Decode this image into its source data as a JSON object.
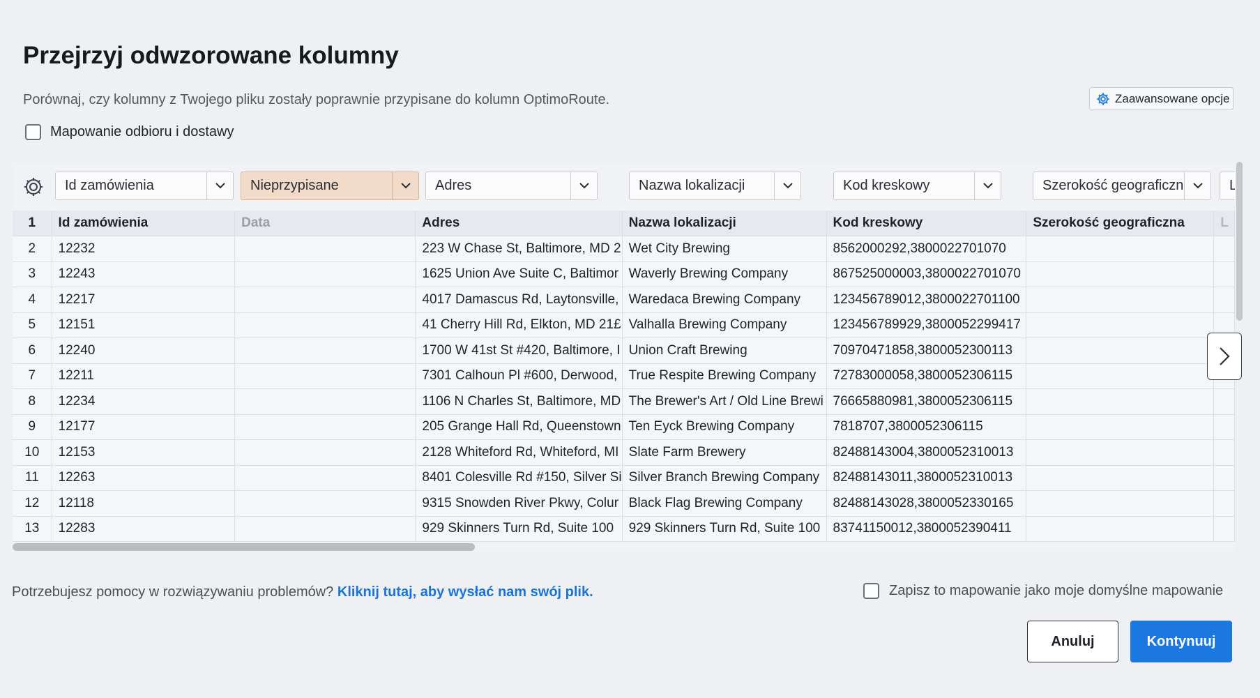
{
  "header": {
    "title": "Przejrzyj odwzorowane kolumny",
    "subtitle": "Porównaj, czy kolumny z Twojego pliku zostały poprawnie przypisane do kolumn OptimoRoute.",
    "advanced_button": "Zaawansowane opcje",
    "pickup_delivery_label": "Mapowanie odbioru i dostawy"
  },
  "mapping": {
    "gear_icon": "column-settings-icon",
    "selects": [
      "Id zamówienia",
      "Nieprzypisane",
      "Adres",
      "Nazwa lokalizacji",
      "Kod kreskowy",
      "Szerokość geograficzna",
      "L"
    ]
  },
  "table": {
    "header_row_number": "1",
    "headers": [
      "Id zamówienia",
      "Data",
      "Adres",
      "Nazwa lokalizacji",
      "Kod kreskowy",
      "Szerokość geograficzna",
      "L"
    ],
    "rows": [
      {
        "n": "2",
        "id": "12232",
        "date": "",
        "address": "223 W Chase St, Baltimore, MD 2",
        "location": "Wet City Brewing",
        "barcode": "8562000292,3800022701070",
        "lat": "",
        "extra": ""
      },
      {
        "n": "3",
        "id": "12243",
        "date": "",
        "address": "1625 Union Ave Suite C, Baltimor",
        "location": "Waverly Brewing Company",
        "barcode": "867525000003,3800022701070",
        "lat": "",
        "extra": ""
      },
      {
        "n": "4",
        "id": "12217",
        "date": "",
        "address": "4017 Damascus Rd, Laytonsville,",
        "location": "Waredaca Brewing Company",
        "barcode": "123456789012,3800022701100",
        "lat": "",
        "extra": ""
      },
      {
        "n": "5",
        "id": "12151",
        "date": "",
        "address": "41 Cherry Hill Rd, Elkton, MD 21£",
        "location": "Valhalla Brewing Company",
        "barcode": "123456789929,3800052299417",
        "lat": "",
        "extra": ""
      },
      {
        "n": "6",
        "id": "12240",
        "date": "",
        "address": "1700 W 41st St #420, Baltimore, I",
        "location": "Union Craft Brewing",
        "barcode": "70970471858,3800052300113",
        "lat": "",
        "extra": ""
      },
      {
        "n": "7",
        "id": "12211",
        "date": "",
        "address": "7301 Calhoun Pl #600, Derwood,",
        "location": "True Respite Brewing Company",
        "barcode": "72783000058,3800052306115",
        "lat": "",
        "extra": ""
      },
      {
        "n": "8",
        "id": "12234",
        "date": "",
        "address": "1106 N Charles St, Baltimore, MD",
        "location": "The Brewer's Art / Old Line Brewi",
        "barcode": "76665880981,3800052306115",
        "lat": "",
        "extra": ""
      },
      {
        "n": "9",
        "id": "12177",
        "date": "",
        "address": "205 Grange Hall Rd, Queenstown",
        "location": "Ten Eyck Brewing Company",
        "barcode": "7818707,3800052306115",
        "lat": "",
        "extra": ""
      },
      {
        "n": "10",
        "id": "12153",
        "date": "",
        "address": "2128 Whiteford Rd, Whiteford, MI",
        "location": "Slate Farm Brewery",
        "barcode": "82488143004,3800052310013",
        "lat": "",
        "extra": ""
      },
      {
        "n": "11",
        "id": "12263",
        "date": "",
        "address": "8401 Colesville Rd #150, Silver Si",
        "location": "Silver Branch Brewing Company",
        "barcode": "82488143011,3800052310013",
        "lat": "",
        "extra": ""
      },
      {
        "n": "12",
        "id": "12118",
        "date": "",
        "address": "9315 Snowden River Pkwy, Colur",
        "location": "Black Flag Brewing Company",
        "barcode": "82488143028,3800052330165",
        "lat": "",
        "extra": ""
      },
      {
        "n": "13",
        "id": "12283",
        "date": "",
        "address": "929 Skinners Turn Rd, Suite 100",
        "location": "929 Skinners Turn Rd, Suite 100",
        "barcode": "83741150012,3800052390411",
        "lat": "",
        "extra": ""
      }
    ]
  },
  "footer": {
    "help_text": "Potrzebujesz pomocy w rozwiązywaniu problemów?",
    "help_link": "Kliknij tutaj, aby wysłać nam swój plik.",
    "save_default_label": "Zapisz to mapowanie jako moje domyślne mapowanie",
    "cancel_button": "Anuluj",
    "continue_button": "Kontynuuj"
  },
  "colors": {
    "primary": "#1a78e0",
    "link": "#1a73d9",
    "unassigned_bg": "#f2dcc9"
  }
}
